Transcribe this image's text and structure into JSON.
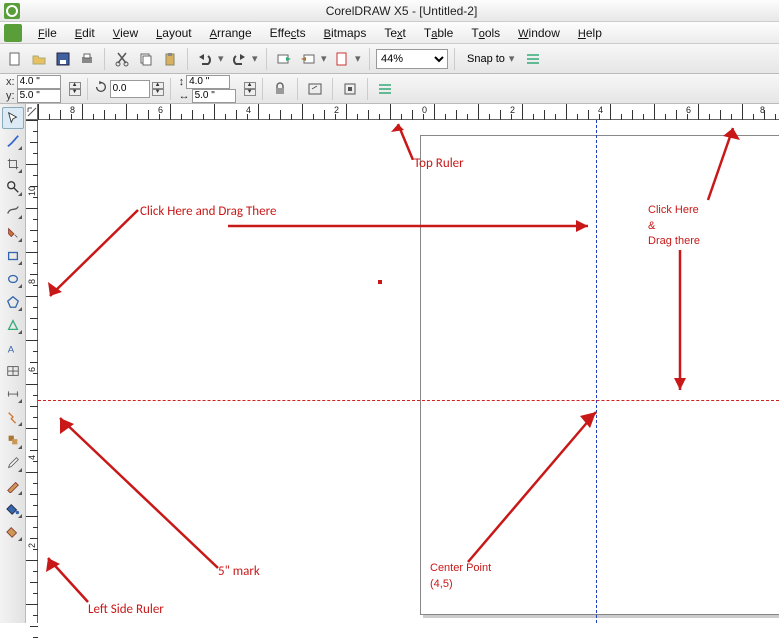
{
  "app": {
    "title": "CorelDRAW X5 - [Untitled-2]"
  },
  "menu": {
    "items": [
      {
        "label": "File",
        "ul": "F"
      },
      {
        "label": "Edit",
        "ul": "E"
      },
      {
        "label": "View",
        "ul": "V"
      },
      {
        "label": "Layout",
        "ul": "L"
      },
      {
        "label": "Arrange",
        "ul": "A"
      },
      {
        "label": "Effects",
        "ul": "f"
      },
      {
        "label": "Bitmaps",
        "ul": "B"
      },
      {
        "label": "Text",
        "ul": "T"
      },
      {
        "label": "Table",
        "ul": "a"
      },
      {
        "label": "Tools",
        "ul": "o"
      },
      {
        "label": "Window",
        "ul": "W"
      },
      {
        "label": "Help",
        "ul": "H"
      }
    ]
  },
  "toolbar": {
    "zoom": "44%",
    "snap_label": "Snap to"
  },
  "propbar": {
    "x_label": "x:",
    "x_val": "4.0 \"",
    "y_label": "y:",
    "y_val": "5.0 \"",
    "rot_val": "0.0",
    "w_val": "4.0 \"",
    "h_val": "5.0 \""
  },
  "ruler_h": {
    "labels": [
      {
        "pos": 68,
        "text": "8"
      },
      {
        "pos": 156,
        "text": "6"
      },
      {
        "pos": 244,
        "text": "4"
      },
      {
        "pos": 332,
        "text": "2"
      },
      {
        "pos": 420,
        "text": "0"
      },
      {
        "pos": 508,
        "text": "2"
      },
      {
        "pos": 596,
        "text": "4"
      },
      {
        "pos": 684,
        "text": "6"
      },
      {
        "pos": 758,
        "text": "8"
      }
    ]
  },
  "ruler_v": {
    "labels": [
      {
        "pos": 76,
        "text": "10"
      },
      {
        "pos": 164,
        "text": "8"
      },
      {
        "pos": 252,
        "text": "6"
      },
      {
        "pos": 340,
        "text": "4"
      },
      {
        "pos": 428,
        "text": "2"
      }
    ]
  },
  "annotations": {
    "top_ruler": "Top Ruler",
    "click_drag_left": "Click Here and Drag There",
    "click_drag_right": "Click Here\n&\nDrag there",
    "five_mark": "5\" mark",
    "center_point": "Center Point\n(4,5)",
    "left_ruler": "Left Side Ruler"
  },
  "colors": {
    "annotation": "#c81818",
    "guide_v": "#2040c0",
    "guide_h": "#d02020"
  }
}
